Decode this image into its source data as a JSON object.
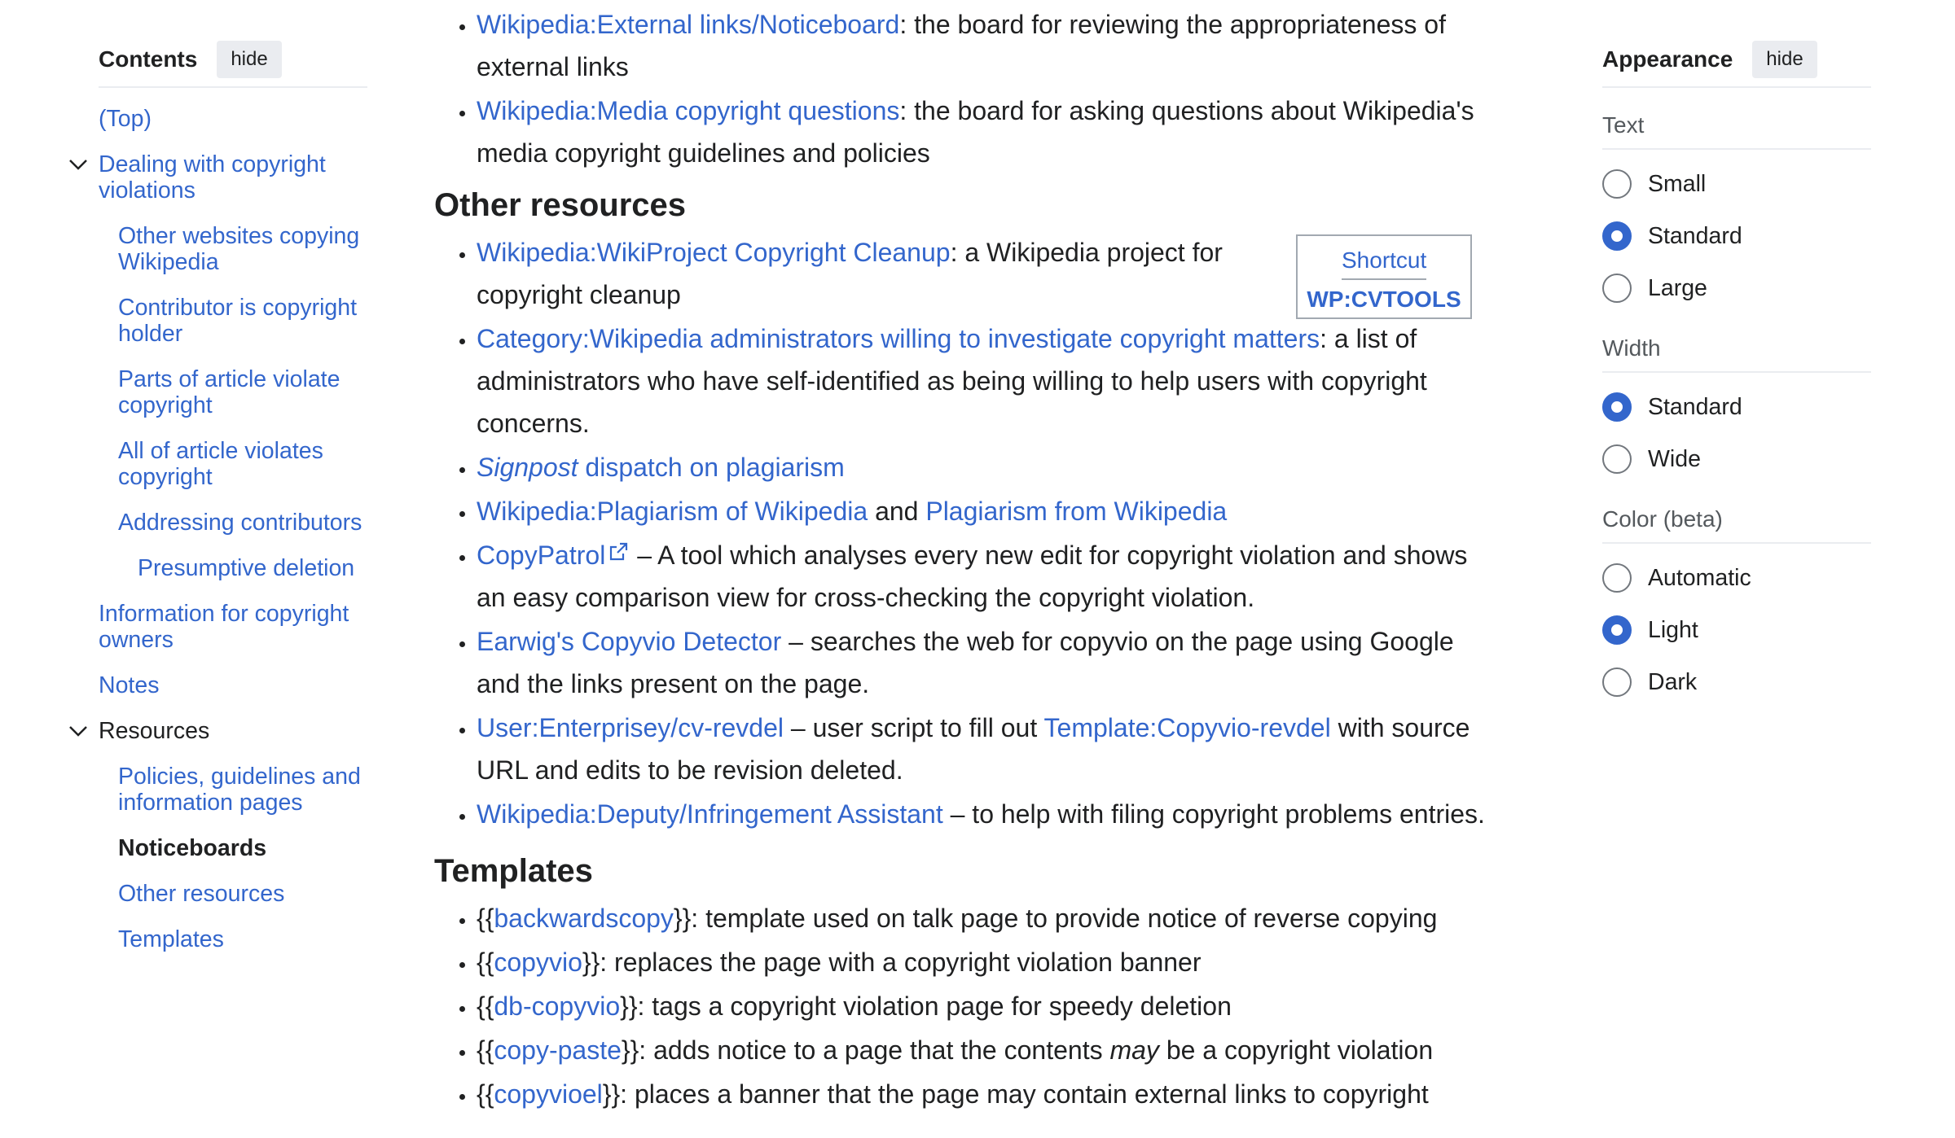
{
  "toc": {
    "title": "Contents",
    "hide_label": "hide",
    "items": [
      {
        "label": "(Top)"
      },
      {
        "label": "Dealing with copyright violations"
      },
      {
        "label": "Other websites copying Wikipedia"
      },
      {
        "label": "Contributor is copyright holder"
      },
      {
        "label": "Parts of article violate copyright"
      },
      {
        "label": "All of article violates copyright"
      },
      {
        "label": "Addressing contributors"
      },
      {
        "label": "Presumptive deletion"
      },
      {
        "label": "Information for copyright owners"
      },
      {
        "label": "Notes"
      },
      {
        "label": "Resources"
      },
      {
        "label": "Policies, guidelines and information pages"
      },
      {
        "label": "Noticeboards"
      },
      {
        "label": "Other resources"
      },
      {
        "label": "Templates"
      }
    ]
  },
  "content": {
    "top_items": [
      {
        "link": "Wikipedia:External links/Noticeboard",
        "text": ": the board for reviewing the appropriateness of external links"
      },
      {
        "link": "Wikipedia:Media copyright questions",
        "text": ": the board for asking questions about Wikipedia's media copyright guidelines and policies"
      }
    ],
    "other_resources_heading": "Other resources",
    "shortcut": {
      "label": "Shortcut",
      "value": "WP:CVTOOLS"
    },
    "resources": [
      {
        "link": "Wikipedia:WikiProject Copyright Cleanup",
        "text": ": a Wikipedia project for copyright cleanup"
      },
      {
        "link": "Category:Wikipedia administrators willing to investigate copyright matters",
        "text": ": a list of administrators who have self-identified as being willing to help users with copyright concerns."
      },
      {
        "link_italic": "Signpost",
        "link": " dispatch on plagiarism"
      },
      {
        "link": "Wikipedia:Plagiarism of Wikipedia",
        "mid": " and ",
        "link2": "Plagiarism from Wikipedia"
      },
      {
        "link": "CopyPatrol",
        "text": " – A tool which analyses every new edit for copyright violation and shows an easy comparison view for cross-checking the copyright violation."
      },
      {
        "link": "Earwig's Copyvio Detector",
        "text": " – searches the web for copyvio on the page using Google and the links present on the page."
      },
      {
        "link": "User:Enterprisey/cv-revdel",
        "mid": " – user script to fill out ",
        "link2": "Template:Copyvio-revdel",
        "text": " with source URL and edits to be revision deleted."
      },
      {
        "link": "Wikipedia:Deputy/Infringement Assistant",
        "text": " – to help with filing copyright problems entries."
      }
    ],
    "templates_heading": "Templates",
    "templates": [
      {
        "open": "{{",
        "link": "backwardscopy",
        "close": "}}",
        "text": ": template used on talk page to provide notice of reverse copying"
      },
      {
        "open": "{{",
        "link": "copyvio",
        "close": "}}",
        "text": ": replaces the page with a copyright violation banner"
      },
      {
        "open": "{{",
        "link": "db-copyvio",
        "close": "}}",
        "text": ": tags a copyright violation page for speedy deletion"
      },
      {
        "open": "{{",
        "link": "copy-paste",
        "close": "}}",
        "text": ": adds notice to a page that the contents ",
        "italic": "may",
        "text2": " be a copyright violation"
      },
      {
        "open": "{{",
        "link": "copyvioel",
        "close": "}}",
        "text": ": places a banner that the page may contain external links to copyright"
      }
    ]
  },
  "appearance": {
    "title": "Appearance",
    "hide_label": "hide",
    "text_label": "Text",
    "text_options": [
      "Small",
      "Standard",
      "Large"
    ],
    "text_selected": "Standard",
    "width_label": "Width",
    "width_options": [
      "Standard",
      "Wide"
    ],
    "width_selected": "Standard",
    "color_label": "Color (beta)",
    "color_options": [
      "Automatic",
      "Light",
      "Dark"
    ],
    "color_selected": "Light"
  },
  "colors": {
    "link": "#3366cc",
    "text": "#202122",
    "accent": "#3366cc"
  }
}
